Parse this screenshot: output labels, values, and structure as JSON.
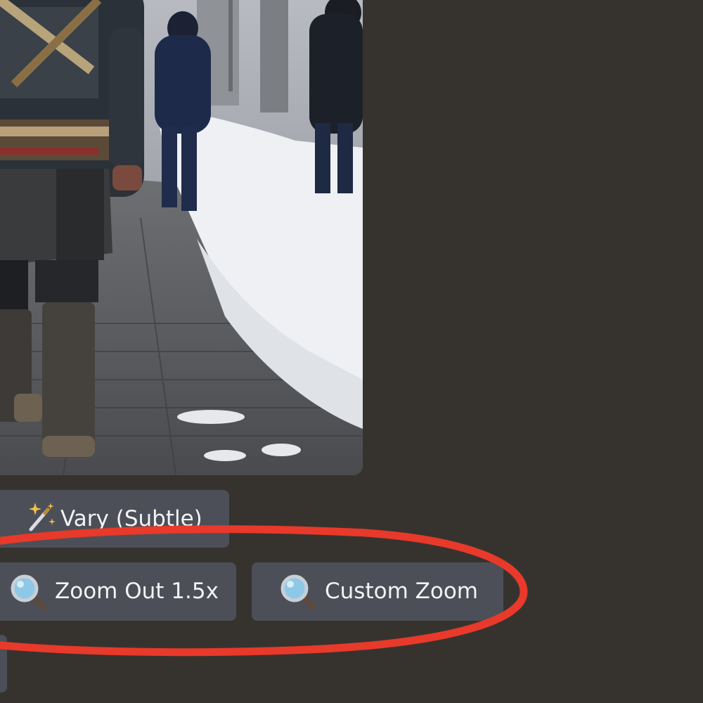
{
  "image": {
    "description_icon": "generated-image"
  },
  "buttons": {
    "vary_subtle": {
      "label": "Vary (Subtle)",
      "icon": "magic-wand-icon"
    },
    "zoom_out": {
      "label": "Zoom Out 1.5x",
      "icon": "magnifying-glass-icon"
    },
    "custom_zoom": {
      "label": "Custom Zoom",
      "icon": "magnifying-glass-icon"
    }
  },
  "annotation": {
    "color": "#e8392a"
  },
  "colors": {
    "background": "#36332f",
    "button": "#4c4f57",
    "button_text": "#f2f3f5"
  }
}
